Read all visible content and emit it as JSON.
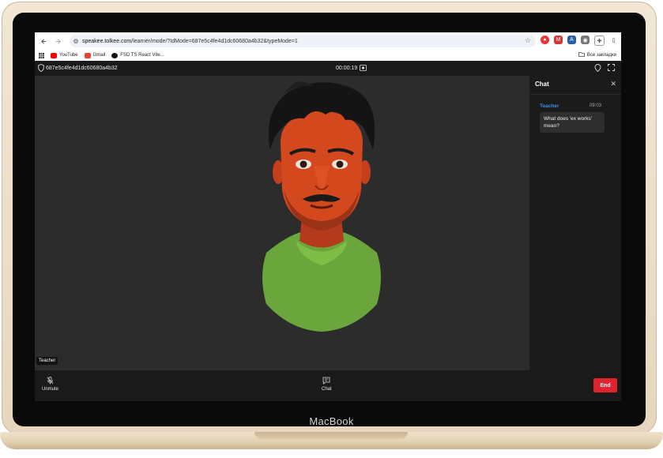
{
  "browser": {
    "url_host": "speakee.tolkee.com",
    "url_path": "/learner/mode/?IdMode=687e5c4fe4d1dc60680a4b32&typeMode=1",
    "bookmarks": [
      {
        "label": "YouTube",
        "icon": "youtube-icon",
        "color": "#ff0000"
      },
      {
        "label": "Gmail",
        "icon": "gmail-icon",
        "color": "#ea4335"
      },
      {
        "label": "FSD TS React Vite...",
        "icon": "github-icon",
        "color": "#111111"
      }
    ],
    "all_bookmarks_label": "Все закладки"
  },
  "app": {
    "session_id": "687e5c4fe4d1dc60680a4b32",
    "timer": "00:00:19",
    "speaker_name": "Teacher",
    "chat": {
      "title": "Chat",
      "messages": [
        {
          "author": "Teacher",
          "time": "09:03",
          "text": "What does 'ex works' mean?"
        }
      ]
    },
    "controls": {
      "unmute_label": "Unmute",
      "chat_label": "Chat",
      "end_label": "End"
    },
    "colors": {
      "end_button": "#e0232e",
      "chat_author": "#3b8ef0"
    }
  },
  "device_label": "MacBook"
}
